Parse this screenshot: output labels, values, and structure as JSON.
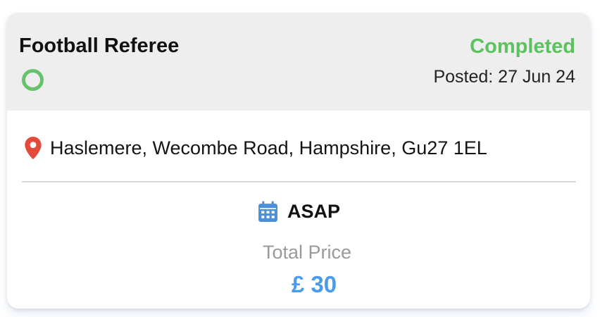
{
  "card": {
    "title": "Football Referee",
    "status": "Completed",
    "posted": "Posted: 27 Jun 24",
    "address": "Haslemere, Wecombe Road, Hampshire, Gu27 1EL",
    "schedule": "ASAP",
    "price_label": "Total Price",
    "price": "£ 30"
  },
  "icons": {
    "status_ring": "circle-outline-icon",
    "location": "map-pin-icon",
    "schedule": "calendar-icon"
  },
  "colors": {
    "status_green": "#5cc15f",
    "pin_red": "#e24a3b",
    "calendar_blue": "#4a8fd8",
    "price_blue": "#4a9bea",
    "header_bg": "#eeeeee"
  }
}
